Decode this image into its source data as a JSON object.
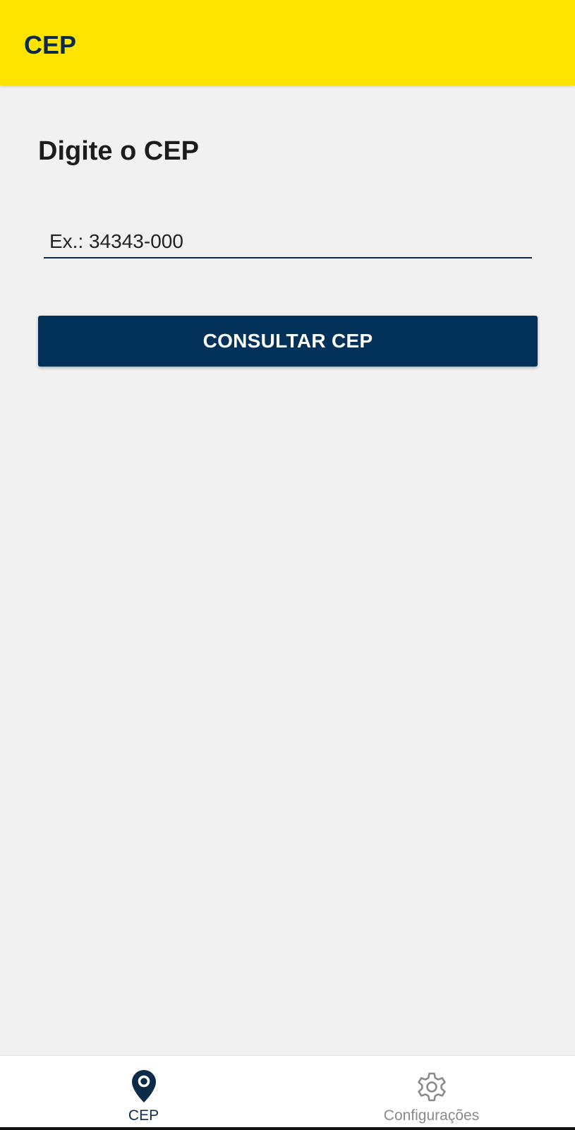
{
  "app_bar": {
    "title": "CEP",
    "background_color": "#ffe400",
    "title_color": "#0c2b48"
  },
  "main": {
    "heading": "Digite o CEP",
    "cep_input": {
      "value": "",
      "placeholder": "Ex.: 34343-000"
    },
    "consult_button_label": "CONSULTAR CEP",
    "button_color": "#02325a"
  },
  "bottom_nav": {
    "items": [
      {
        "label": "CEP",
        "icon": "location-pin-icon",
        "active": true
      },
      {
        "label": "Configurações",
        "icon": "gear-icon",
        "active": false
      }
    ]
  }
}
